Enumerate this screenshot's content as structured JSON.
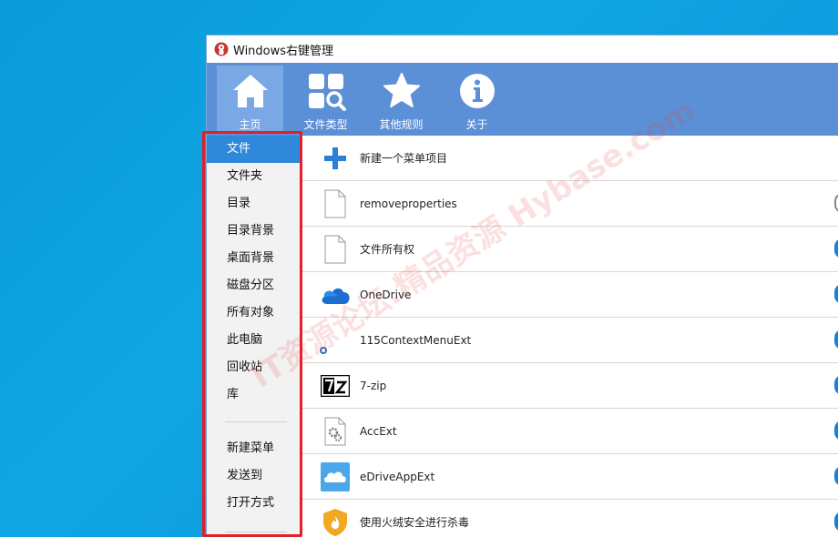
{
  "window": {
    "title": "Windows右键管理",
    "app_icon": "red-white-badge-icon"
  },
  "toolbar": {
    "buttons": [
      {
        "label": "主页",
        "icon": "home-icon",
        "active": true
      },
      {
        "label": "文件类型",
        "icon": "file-types-icon",
        "active": false
      },
      {
        "label": "其他规则",
        "icon": "star-icon",
        "active": false
      },
      {
        "label": "关于",
        "icon": "info-icon",
        "active": false
      }
    ]
  },
  "sidebar": {
    "items": [
      {
        "label": "文件",
        "active": true
      },
      {
        "label": "文件夹"
      },
      {
        "label": "目录"
      },
      {
        "label": "目录背景"
      },
      {
        "label": "桌面背景"
      },
      {
        "label": "磁盘分区"
      },
      {
        "label": "所有对象"
      },
      {
        "label": "此电脑"
      },
      {
        "label": "回收站"
      },
      {
        "label": "库"
      }
    ],
    "items2": [
      {
        "label": "新建菜单"
      },
      {
        "label": "发送到"
      },
      {
        "label": "打开方式"
      }
    ]
  },
  "list": {
    "rows": [
      {
        "label": "新建一个菜单项目",
        "icon": "plus-icon",
        "toggle": null
      },
      {
        "label": "removeproperties",
        "icon": "blank-file-icon",
        "toggle": "off"
      },
      {
        "label": "文件所有权",
        "icon": "blank-file-icon",
        "toggle": "on"
      },
      {
        "label": "OneDrive",
        "icon": "onedrive-cloud-icon",
        "toggle": "on"
      },
      {
        "label": "115ContextMenuExt",
        "icon": "115-icon",
        "toggle": "on"
      },
      {
        "label": "7-zip",
        "icon": "7zip-icon",
        "toggle": "on"
      },
      {
        "label": "AccExt",
        "icon": "gear-file-icon",
        "toggle": "on"
      },
      {
        "label": "eDriveAppExt",
        "icon": "cloud-drive-icon",
        "toggle": "on"
      },
      {
        "label": "使用火绒安全进行杀毒",
        "icon": "huorong-shield-icon",
        "toggle": "on"
      }
    ]
  },
  "watermark": {
    "text": "IT资源论坛.精品资源 Hybase.com"
  },
  "colors": {
    "toolbar": "#5b8fd6",
    "active_tool": "#7aa8e4",
    "sidebar_active": "#2f88da",
    "highlight": "#e0202a",
    "toggle_on": "#1e7fd4"
  }
}
